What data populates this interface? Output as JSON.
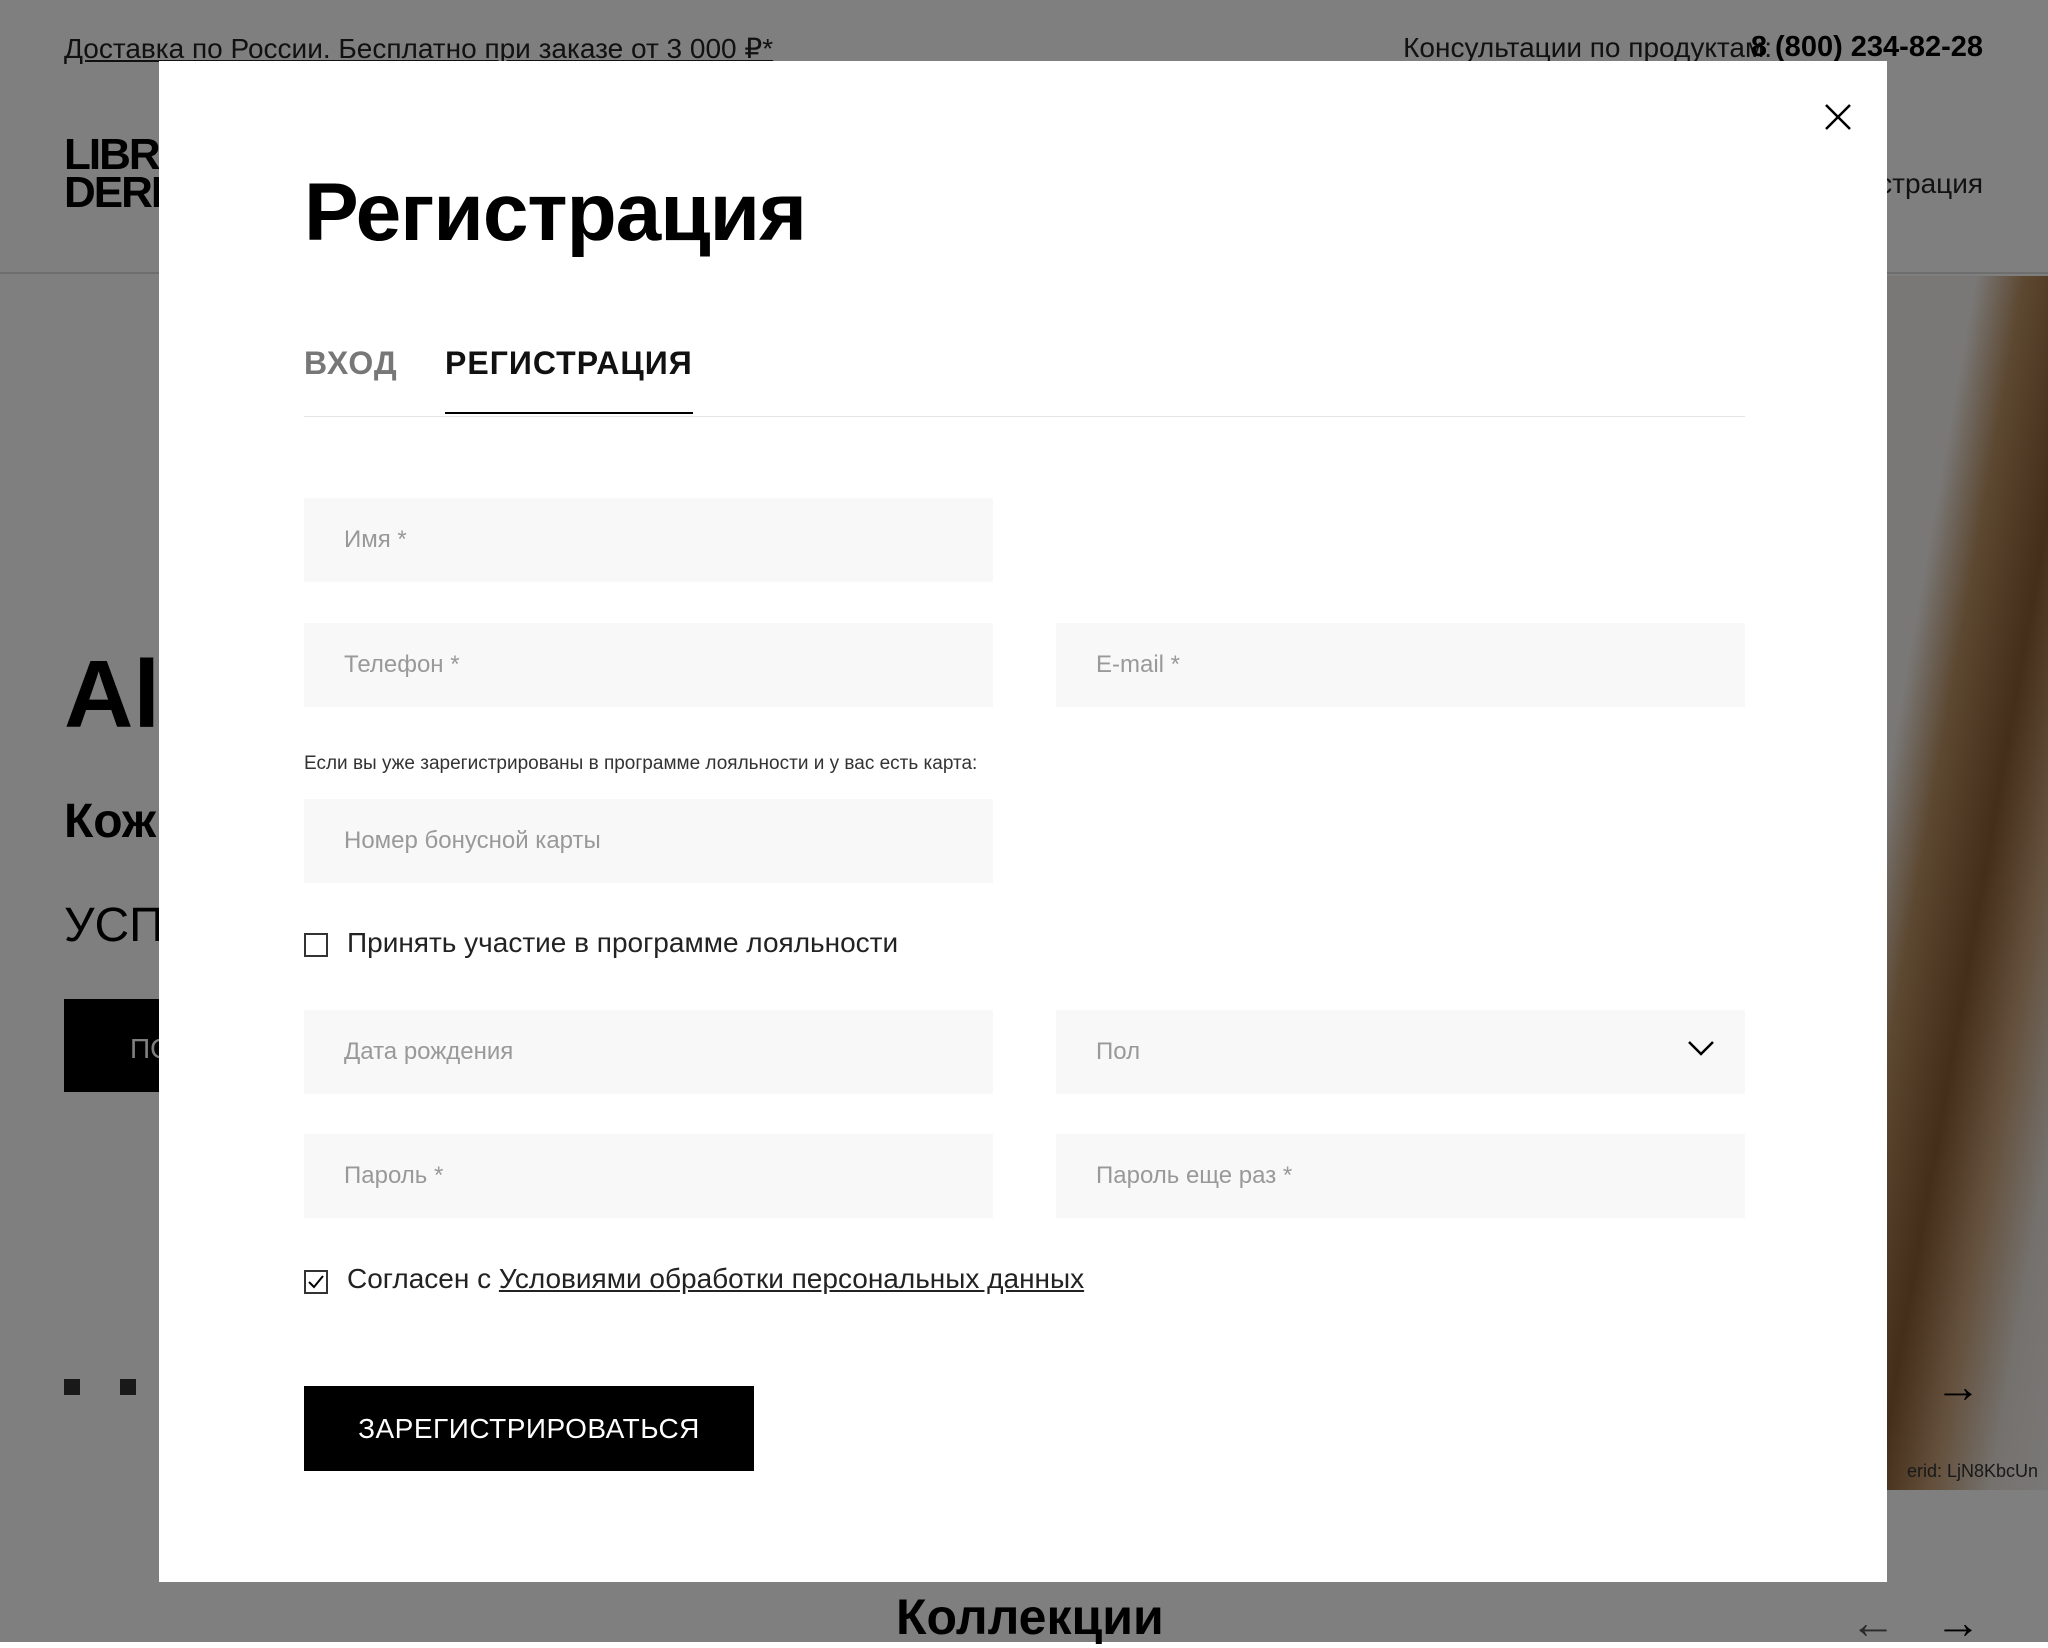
{
  "topbar": {
    "delivery": "Доставка по России. Бесплатно при заказе от 3 000 ₽*",
    "consult_label": "Консультации по продуктам:",
    "phone": "8 (800) 234-82-28"
  },
  "header": {
    "logo_line1": "LIBRE",
    "logo_line2": "DERMA",
    "nav_register": "Регистрация"
  },
  "hero": {
    "title": "Al",
    "subtitle": "Кож",
    "text": "УСП",
    "button": "ПО",
    "erid": "erid: LjN8KbcUn",
    "prev_arrow": "←",
    "next_arrow": "→"
  },
  "collections": {
    "title": "Коллекции",
    "prev_arrow": "←",
    "next_arrow": "→"
  },
  "modal": {
    "title": "Регистрация",
    "tabs": [
      {
        "label": "ВХОД",
        "active": false
      },
      {
        "label": "РЕГИСТРАЦИЯ",
        "active": true
      }
    ],
    "fields": {
      "name": "Имя *",
      "phone": "Телефон *",
      "email": "E-mail *",
      "card": "Номер бонусной карты",
      "dob": "Дата рождения",
      "gender": "Пол",
      "password": "Пароль *",
      "password2": "Пароль еще раз *"
    },
    "loyalty_note": "Если вы уже зарегистрированы в программе лояльности и у вас есть карта:",
    "loyalty_checkbox": {
      "label": "Принять участие в программе лояльности",
      "checked": false
    },
    "consent_checkbox": {
      "prefix": "Согласен с ",
      "link": "Условиями обработки персональных данных",
      "checked": true
    },
    "submit": "ЗАРЕГИСТРИРОВАТЬСЯ"
  },
  "colors": {
    "overlay": "#808080",
    "input_bg": "#f8f8f8",
    "button": "#000000"
  }
}
